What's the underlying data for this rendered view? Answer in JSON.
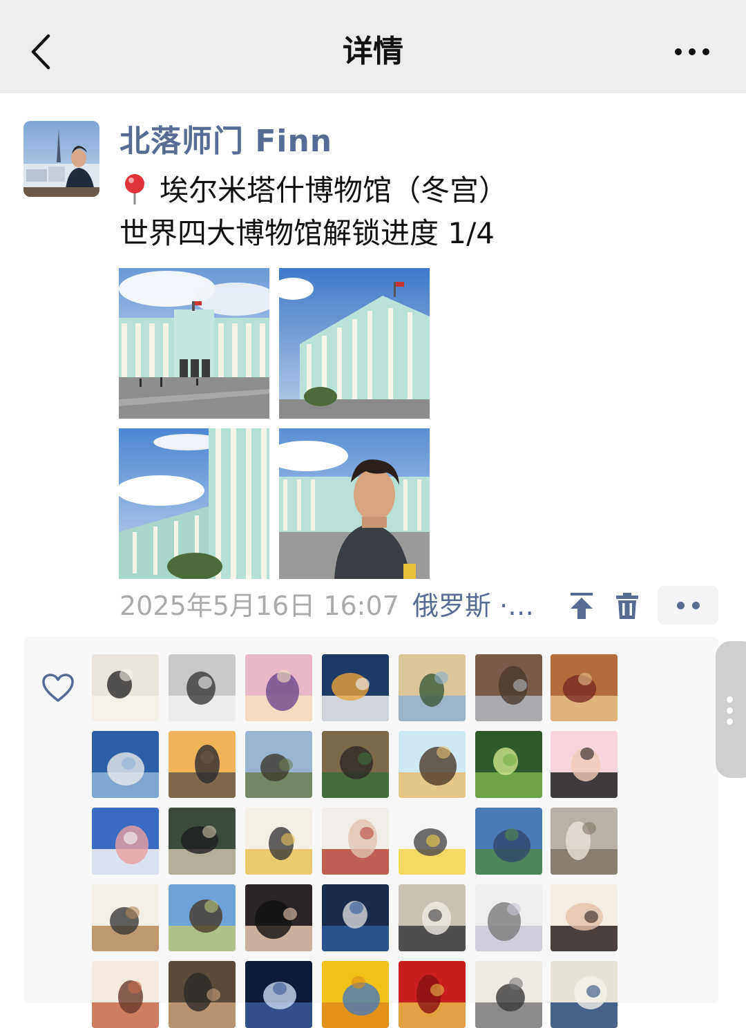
{
  "header": {
    "title": "详情",
    "back_icon": "chevron-left-icon",
    "more_icon": "more-horizontal-icon"
  },
  "post": {
    "author": "北落师门 Finn",
    "location_line": "埃尔米塔什博物馆（冬宫）",
    "caption": "世界四大博物馆解锁进度 1/4",
    "photo_count": 4,
    "timestamp": "2025年5月16日 16:07",
    "location_tag": "俄罗斯 ·…",
    "icons": [
      "pin-top-icon",
      "trash-icon",
      "more-dots-icon"
    ]
  },
  "likes": {
    "icon": "heart-outline-icon",
    "liker_count_visible": 35
  },
  "colors": {
    "header_bg": "#ededed",
    "link_blue": "#576b95",
    "muted_gray": "#aaaaaa",
    "panel_bg": "#f7f7f7",
    "palace_mint": "#a8d8cf",
    "sky_blue": "#5d93d6"
  }
}
